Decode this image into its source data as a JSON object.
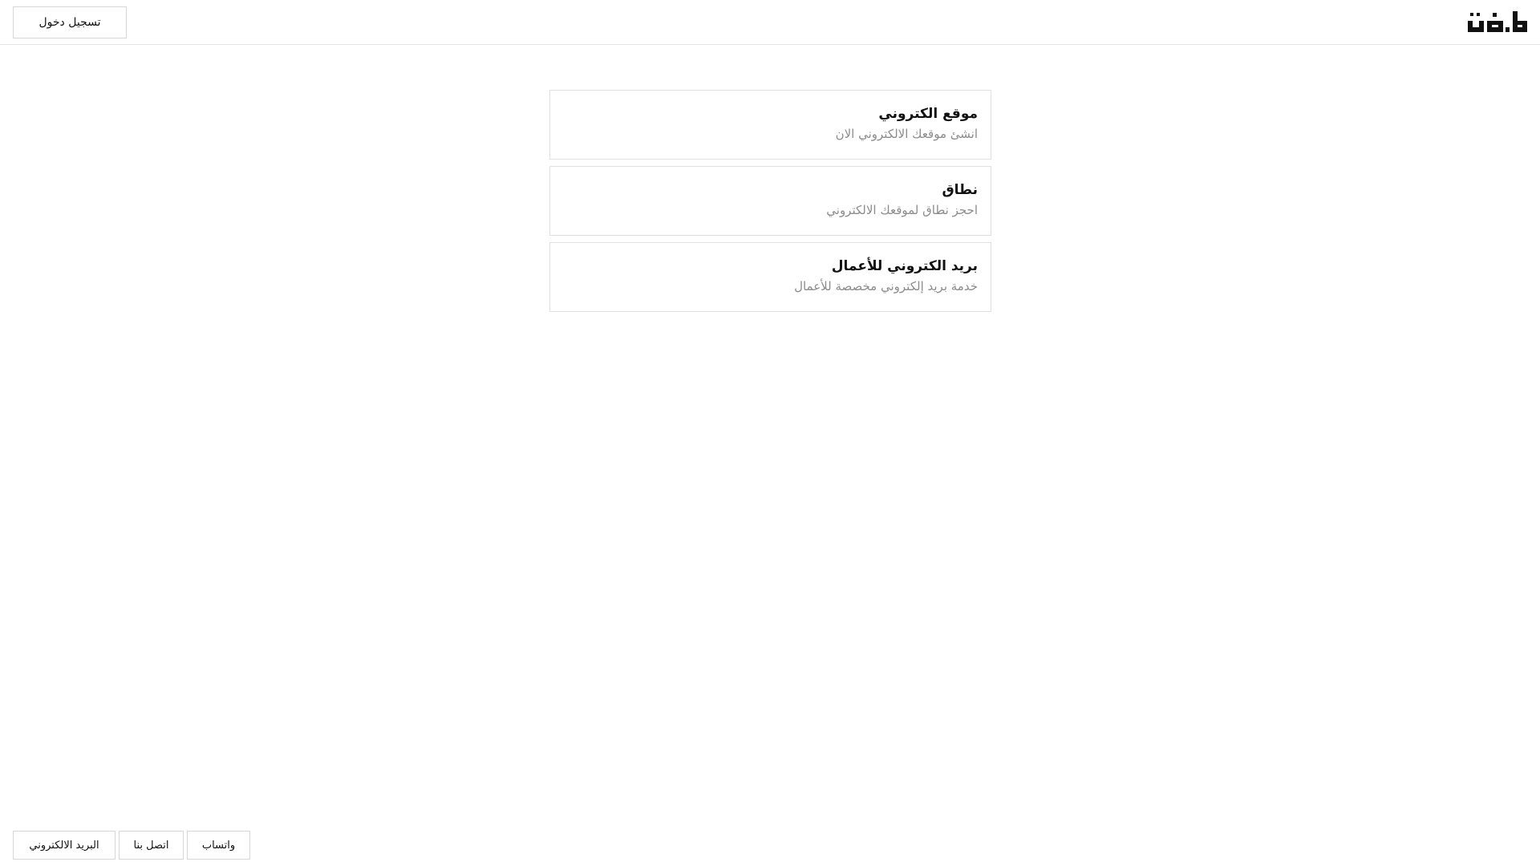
{
  "header": {
    "login_label": "تسجيل دخول",
    "logo_icon": "brand-logo-icon"
  },
  "services": [
    {
      "title": "موقع الكتروني",
      "subtitle": "انشئ موقعك الالكتروني الان"
    },
    {
      "title": "نطاق",
      "subtitle": "احجز نطاق لموقعك الالكتروني"
    },
    {
      "title": "بريد الكتروني للأعمال",
      "subtitle": "خدمة بريد إلكتروني مخصصة للأعمال"
    }
  ],
  "footer": {
    "email_label": "البريد الالكتروني",
    "contact_label": "اتصل بنا",
    "whatsapp_label": "واتساب"
  },
  "colors": {
    "border": "#e0e0e0",
    "subtitle": "#8c8c8c",
    "text": "#111111"
  }
}
